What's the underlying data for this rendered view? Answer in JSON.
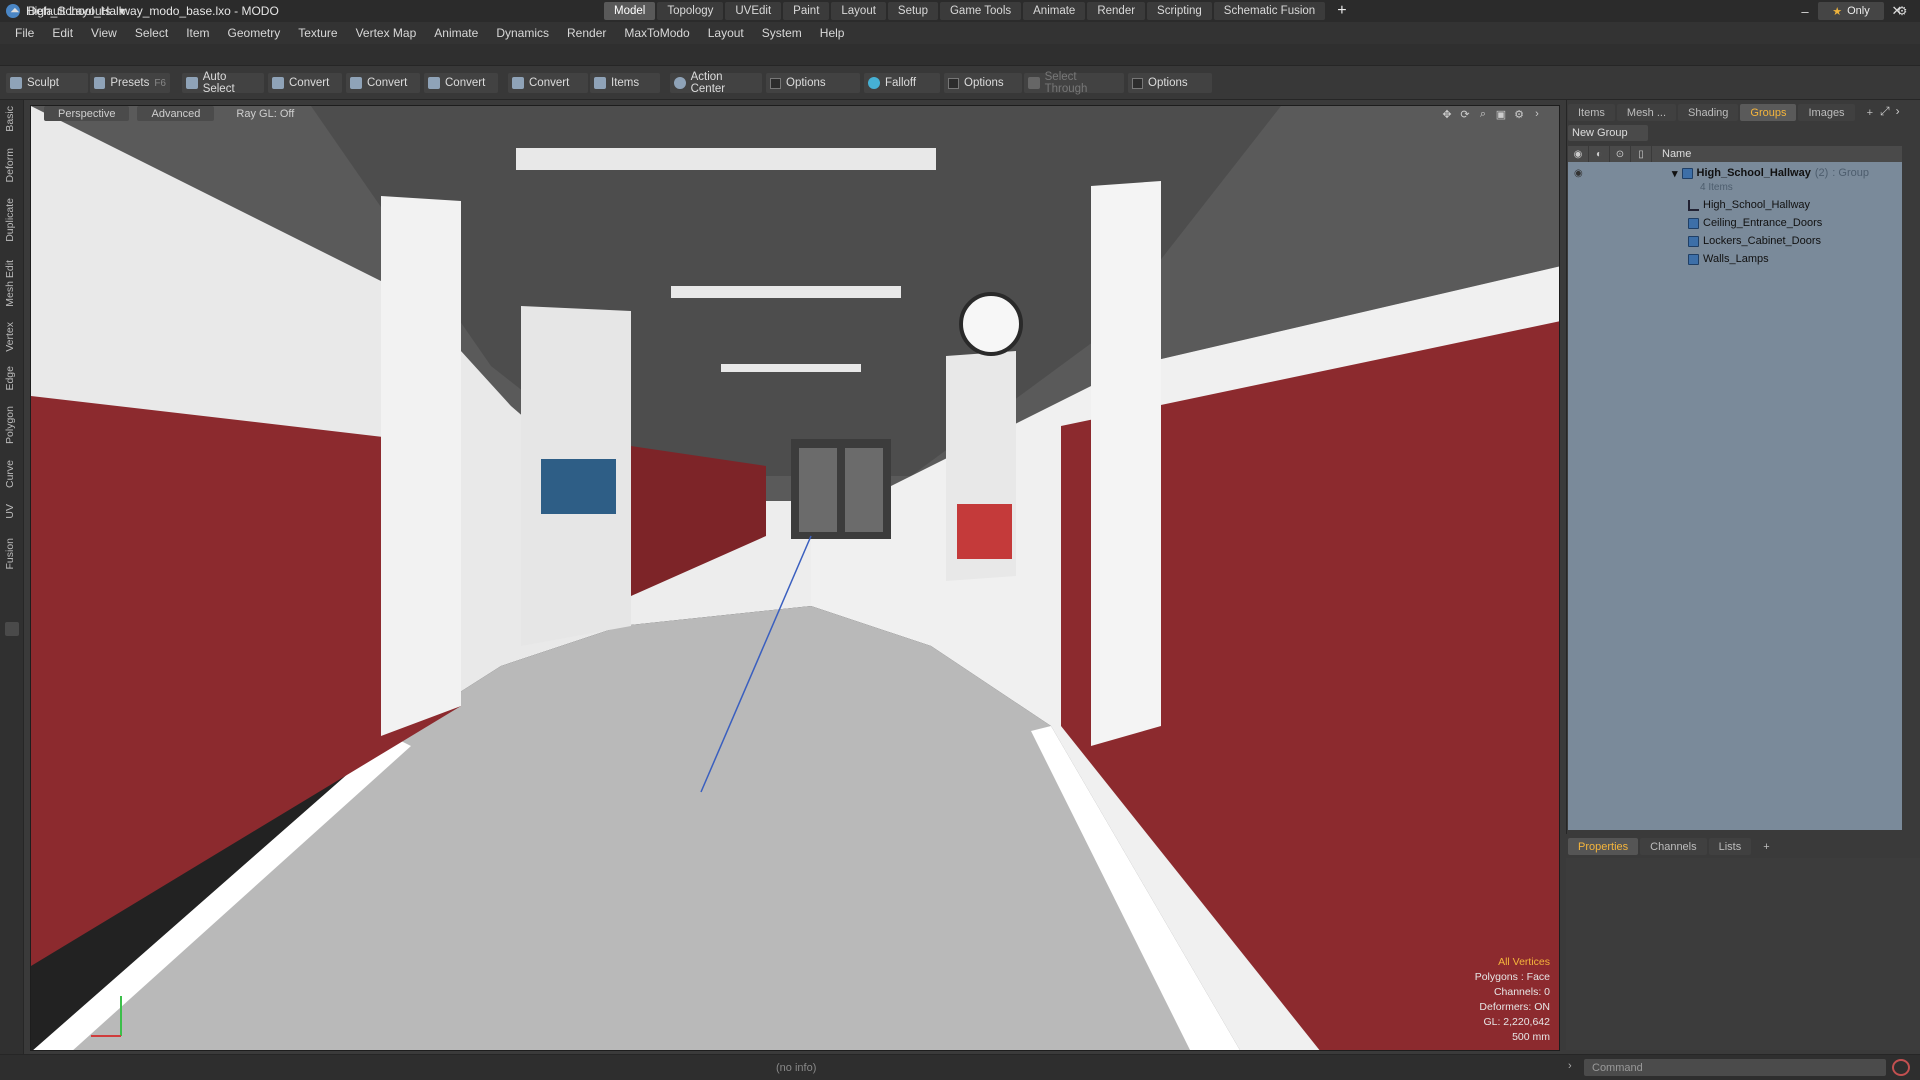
{
  "window": {
    "title": "High_School_Hallway_modo_base.lxo - MODO",
    "controls": [
      "–",
      "❐",
      "✕"
    ]
  },
  "menu": [
    "File",
    "Edit",
    "View",
    "Select",
    "Item",
    "Geometry",
    "Texture",
    "Vertex Map",
    "Animate",
    "Dynamics",
    "Render",
    "MaxToModo",
    "Layout",
    "System",
    "Help"
  ],
  "layout": {
    "selector": "Default Layouts",
    "tabs": [
      "Model",
      "Topology",
      "UVEdit",
      "Paint",
      "Layout",
      "Setup",
      "Game Tools",
      "Animate",
      "Render",
      "Scripting",
      "Schematic Fusion"
    ],
    "active_tab": "Model",
    "only_label": "Only"
  },
  "toolbar": {
    "sculpt": "Sculpt",
    "presets": "Presets",
    "presets_hotkey": "F6",
    "auto_select": "Auto Select",
    "convert1": "Convert",
    "convert2": "Convert",
    "convert3": "Convert",
    "convert4": "Convert",
    "items": "Items",
    "action_center": "Action Center",
    "options1": "Options",
    "falloff": "Falloff",
    "options2": "Options",
    "select_through": "Select Through",
    "options3": "Options"
  },
  "left_tabs": [
    "Basic",
    "Deform",
    "Duplicate",
    "Mesh Edit",
    "Vertex",
    "Edge",
    "Polygon",
    "Curve",
    "UV",
    "Fusion"
  ],
  "viewport": {
    "view_mode": "Perspective",
    "shading": "Advanced",
    "raygl": "Ray GL: Off",
    "info": {
      "selection": "All Vertices",
      "polygons": "Polygons : Face",
      "channels": "Channels: 0",
      "deformers": "Deformers: ON",
      "gl": "GL: 2,220,642",
      "grid": "500 mm"
    }
  },
  "right_panel": {
    "tabs": [
      "Items",
      "Mesh ...",
      "Shading",
      "Groups",
      "Images"
    ],
    "active_tab": "Groups",
    "new_group": "New Group",
    "column_name": "Name",
    "group": {
      "name": "High_School_Hallway",
      "count": "(2)",
      "type": ": Group",
      "items_count": "4 Items",
      "children": [
        "High_School_Hallway",
        "Ceiling_Entrance_Doors",
        "Lockers_Cabinet_Doors",
        "Walls_Lamps"
      ]
    }
  },
  "properties": {
    "tabs": [
      "Properties",
      "Channels",
      "Lists"
    ],
    "active_tab": "Properties"
  },
  "statusbar": {
    "info": "(no info)",
    "command_placeholder": "Command"
  },
  "colors": {
    "accent": "#f5b53c",
    "locker_red": "#8c2a2e",
    "group_panel": "#7a8a9a"
  }
}
